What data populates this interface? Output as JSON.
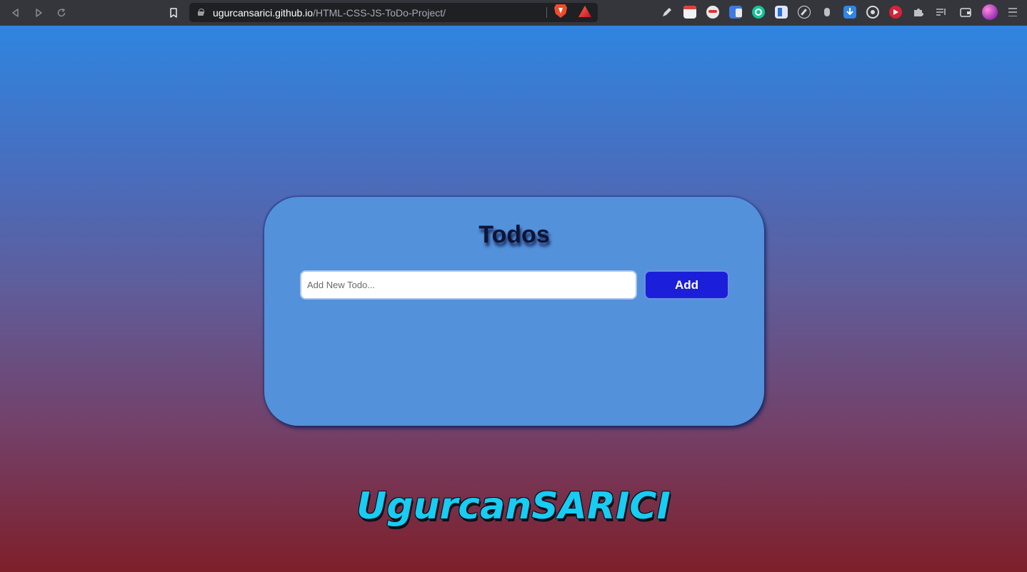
{
  "browser": {
    "url_host": "ugurcansarici.github.io",
    "url_path": "/HTML-CSS-JS-ToDo-Project/",
    "icons": {
      "back": "back-arrow-icon",
      "forward": "forward-arrow-icon",
      "reload": "reload-icon",
      "bookmark": "bookmark-icon",
      "lock": "lock-icon",
      "shields": "brave-shields-icon",
      "rewards": "brave-rewards-icon",
      "menu": "menu-icon"
    }
  },
  "app": {
    "title": "Todos",
    "input_placeholder": "Add New Todo...",
    "input_value": "",
    "add_label": "Add",
    "signature": "UgurcanSARICI"
  },
  "colors": {
    "card": "#5391db",
    "add_button": "#1b1fd9",
    "signature": "#18ccf2",
    "gradient_top": "#2f85e0",
    "gradient_bottom": "#7e1f2a"
  }
}
